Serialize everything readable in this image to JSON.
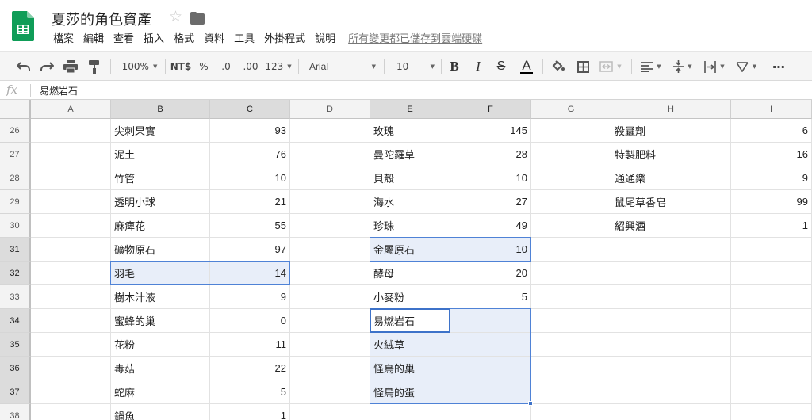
{
  "app": {
    "title": "夏莎的角色資產",
    "menu": [
      "檔案",
      "編輯",
      "查看",
      "插入",
      "格式",
      "資料",
      "工具",
      "外掛程式",
      "說明"
    ],
    "save_status": "所有變更都已儲存到雲端硬碟",
    "icons": [
      "sheets-logo-icon",
      "star-icon",
      "folder-icon"
    ],
    "colors": {
      "logo_green": "#0f9d58",
      "selection_border": "#3d72c9",
      "selection_fill": "#e8eef9"
    }
  },
  "toolbar": {
    "zoom": "100%",
    "currency": "NT$",
    "percent": "%",
    "decimal_decrease": ".0",
    "decimal_increase": ".00",
    "number_format": "123",
    "font": "Arial",
    "font_size": "10",
    "bold": "B",
    "italic": "I",
    "strikethrough": "S",
    "text_color": "A",
    "more": "⋯"
  },
  "formula_bar": {
    "fx": "fx",
    "value": "易燃岩石"
  },
  "columns": [
    "A",
    "B",
    "C",
    "D",
    "E",
    "F",
    "G",
    "H",
    "I"
  ],
  "rows": [
    {
      "n": "26",
      "B": "尖刺果實",
      "C": "93",
      "E": "玫瑰",
      "F": "145",
      "H": "殺蟲劑",
      "I": "6"
    },
    {
      "n": "27",
      "B": "泥土",
      "C": "76",
      "E": "曼陀羅草",
      "F": "28",
      "H": "特製肥料",
      "I": "16"
    },
    {
      "n": "28",
      "B": "竹管",
      "C": "10",
      "E": "貝殼",
      "F": "10",
      "H": "通通樂",
      "I": "9"
    },
    {
      "n": "29",
      "B": "透明小球",
      "C": "21",
      "E": "海水",
      "F": "27",
      "H": "鼠尾草香皂",
      "I": "99"
    },
    {
      "n": "30",
      "B": "麻痺花",
      "C": "55",
      "E": "珍珠",
      "F": "49",
      "H": "紹興酒",
      "I": "1"
    },
    {
      "n": "31",
      "B": "礦物原石",
      "C": "97",
      "E": "金屬原石",
      "F": "10",
      "H": "",
      "I": ""
    },
    {
      "n": "32",
      "B": "羽毛",
      "C": "14",
      "E": "酵母",
      "F": "20",
      "H": "",
      "I": ""
    },
    {
      "n": "33",
      "B": "樹木汁液",
      "C": "9",
      "E": "小麥粉",
      "F": "5",
      "H": "",
      "I": ""
    },
    {
      "n": "34",
      "B": "蜜蜂的巢",
      "C": "0",
      "E": "易燃岩石",
      "F": "",
      "H": "",
      "I": ""
    },
    {
      "n": "35",
      "B": "花粉",
      "C": "11",
      "E": "火絨草",
      "F": "",
      "H": "",
      "I": ""
    },
    {
      "n": "36",
      "B": "毒菇",
      "C": "22",
      "E": "怪鳥的巢",
      "F": "",
      "H": "",
      "I": ""
    },
    {
      "n": "37",
      "B": "蛇麻",
      "C": "5",
      "E": "怪鳥的蛋",
      "F": "",
      "H": "",
      "I": ""
    },
    {
      "n": "38",
      "B": "鍋魚",
      "C": "1",
      "E": "",
      "F": "",
      "H": "",
      "I": ""
    }
  ]
}
